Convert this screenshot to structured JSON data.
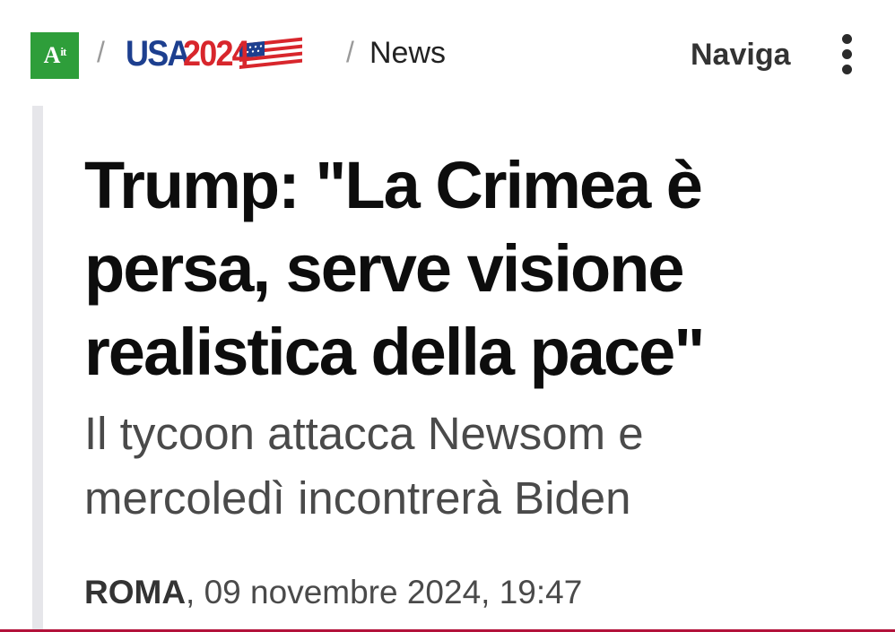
{
  "header": {
    "logo_text": "A",
    "logo_sup": "it",
    "separator": "/",
    "section_usa": "USA",
    "section_year": "2024",
    "breadcrumb_current": "News",
    "nav_label": "Naviga",
    "menu_icon": "kebab-menu-icon",
    "flag_icon": "us-flag-icon"
  },
  "article": {
    "headline": "Trump: \"La Crimea è persa, serve visione realistica della pace\"",
    "subtitle": "Il tycoon attacca Newsom e mercoledì incontrerà Biden",
    "place": "ROMA",
    "date": ", 09 novembre 2024, 19:47"
  },
  "colors": {
    "logo_bg": "#2e9e3a",
    "usa_blue": "#1d3f8f",
    "usa_red": "#d8262c",
    "accent_bar": "#e6e6ea",
    "bottom_line": "#b3123a"
  }
}
